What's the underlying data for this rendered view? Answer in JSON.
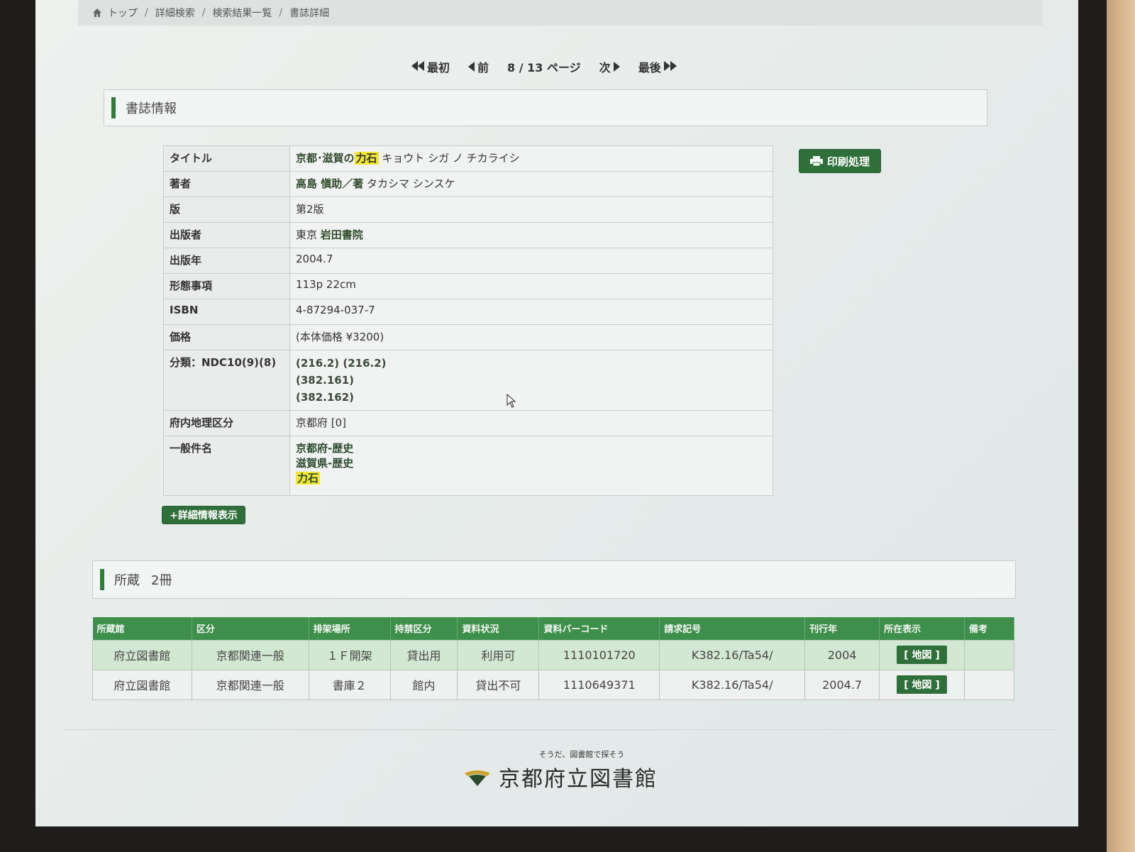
{
  "breadcrumb": {
    "items": [
      "トップ",
      "詳細検索",
      "検索結果一覧",
      "書誌詳細"
    ],
    "separator": "/"
  },
  "pager": {
    "first": "最初",
    "prev": "前",
    "status": "8 / 13 ページ",
    "next": "次",
    "last": "最後"
  },
  "biblio_section": {
    "title": "書誌情報"
  },
  "print_button": "印刷処理",
  "biblio": {
    "title_label": "タイトル",
    "title_part1": "京都･滋賀の",
    "title_hl": "力石",
    "title_kana": "キョウト シガ ノ チカライシ",
    "author_label": "著者",
    "author_value": "高島 愼助／著",
    "author_kana": "タカシマ シンスケ",
    "edition_label": "版",
    "edition_value": "第2版",
    "publisher_label": "出版者",
    "publisher_place": "東京",
    "publisher_name": "岩田書院",
    "year_label": "出版年",
    "year_value": "2004.7",
    "physical_label": "形態事項",
    "physical_value": "113p 22cm",
    "isbn_label": "ISBN",
    "isbn_value": "4-87294-037-7",
    "price_label": "価格",
    "price_value": "(本体価格 ¥3200)",
    "class_label": "分類：NDC10(9)(8)",
    "class_line1": "(216.2) (216.2)",
    "class_line2": "(382.161)",
    "class_line3": "(382.162)",
    "region_label": "府内地理区分",
    "region_value": "京都府 [0]",
    "subject_label": "一般件名",
    "subject_1": "京都府-歴史",
    "subject_2": "滋賀県-歴史",
    "subject_3": "力石"
  },
  "details_button": "+詳細情報表示",
  "holdings_section": {
    "title": "所蔵",
    "count": "2冊"
  },
  "holdings": {
    "headers": [
      "所蔵館",
      "区分",
      "排架場所",
      "持禁区分",
      "資料状況",
      "資料バーコード",
      "請求記号",
      "刊行年",
      "所在表示",
      "備考"
    ],
    "rows": [
      [
        "府立図書館",
        "京都関連一般",
        "１Ｆ開架",
        "貸出用",
        "利用可",
        "1110101720",
        "K382.16/Ta54/",
        "2004",
        "[ 地図 ]",
        ""
      ],
      [
        "府立図書館",
        "京都関連一般",
        "書庫２",
        "館内",
        "貸出不可",
        "1110649371",
        "K382.16/Ta54/",
        "2004.7",
        "[ 地図 ]",
        ""
      ]
    ]
  },
  "footer": {
    "tagline": "そうだ、図書館で探そう",
    "library_name": "京都府立図書館"
  },
  "colors": {
    "accent": "#2f6f3a",
    "header_green": "#3f8f4c",
    "highlight": "#f2e733"
  }
}
